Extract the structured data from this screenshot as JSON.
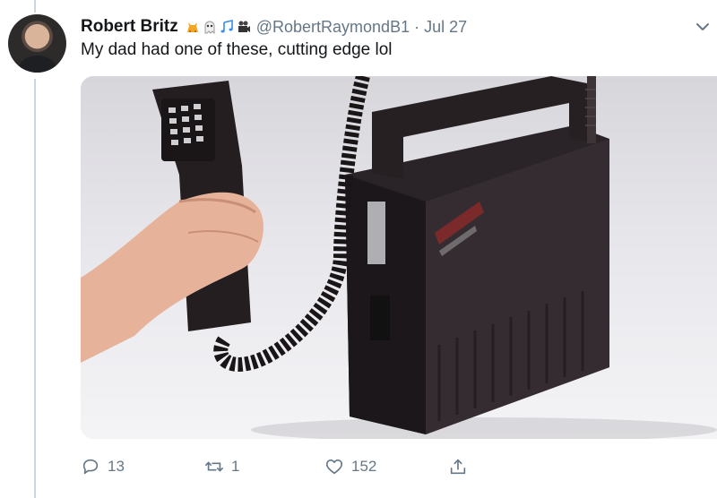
{
  "tweet": {
    "author_name": "Robert Britz",
    "author_handle": "@RobertRaymondB1",
    "separator": "·",
    "date": "Jul 27",
    "text": "My dad had one of these, cutting edge lol",
    "name_emojis": [
      "cat-emoji",
      "ghost-emoji",
      "music-notes-emoji",
      "movie-camera-emoji"
    ],
    "image_alt": "Vintage bag phone with coiled cord and handset held in a hand"
  },
  "actions": {
    "replies": "13",
    "retweets": "1",
    "likes": "152"
  },
  "colors": {
    "secondary_text": "#657786",
    "primary_text": "#14171a",
    "thread_line": "#ccd6dd"
  }
}
